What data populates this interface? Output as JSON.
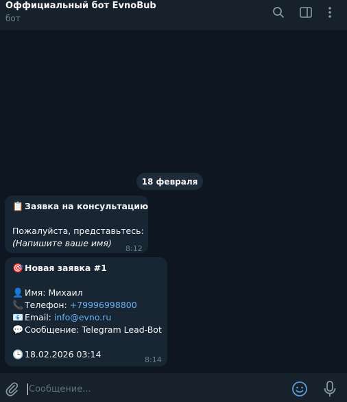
{
  "header": {
    "title": "Оффициальный бот EvnoBub",
    "subtitle": "бот",
    "icons": [
      "search-icon",
      "sidebar-toggle-icon",
      "more-vertical-icon"
    ]
  },
  "date_separator": "18 февраля",
  "messages": [
    {
      "title_emoji": "📋",
      "title": "Заявка на консультацию",
      "body": "Пожалуйста, представьтесь:",
      "hint": "(Напишите ваше имя)",
      "time": "8:12"
    },
    {
      "title_emoji": "🎯",
      "title": "Новая заявка #1",
      "name_emoji": "👤",
      "name_label": "Имя:",
      "name_value": "Михаил",
      "phone_emoji": "📞",
      "phone_label": "Телефон:",
      "phone_value": "+79996998800",
      "email_emoji": "📧",
      "email_label": "Email:",
      "email_value": "info@evno.ru",
      "message_emoji": "💬",
      "message_label": "Сообщение:",
      "message_value": "Telegram Lead-Bot",
      "date_emoji": "🕒",
      "date_value": "18.02.2026 03:14",
      "time": "8:14"
    }
  ],
  "composer": {
    "placeholder": "Сообщение...",
    "icons": [
      "attach-icon",
      "emoji-icon",
      "microphone-icon"
    ]
  },
  "colors": {
    "background": "#0e1621",
    "panel": "#17212b",
    "bubble": "#182533",
    "link": "#6ab3f3",
    "muted": "#6d7f8f"
  }
}
